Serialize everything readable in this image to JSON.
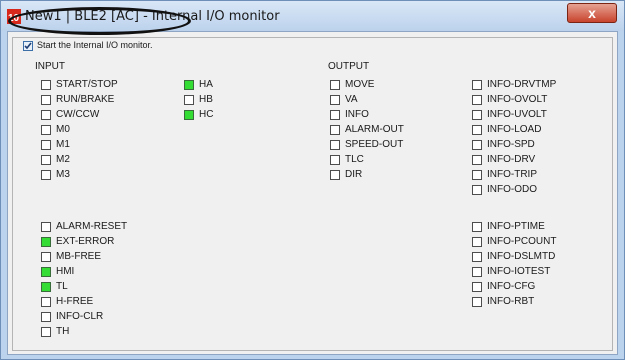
{
  "window": {
    "title": "New1 | BLE2 [AC] - Internal I/O monitor",
    "close_glyph": "x",
    "app_icon": "motor-app-icon",
    "title_bg": "#bcd3ee"
  },
  "start_monitor": {
    "label": "Start the Internal I/O monitor.",
    "checked": true
  },
  "input_header": "INPUT",
  "output_header": "OUTPUT",
  "colors": {
    "on": "#33dd33",
    "off": "#ffffff"
  },
  "io": {
    "start_stop": {
      "label": "START/STOP",
      "on": false
    },
    "run_brake": {
      "label": "RUN/BRAKE",
      "on": false
    },
    "cw_ccw": {
      "label": "CW/CCW",
      "on": false
    },
    "m0": {
      "label": "M0",
      "on": false
    },
    "m1": {
      "label": "M1",
      "on": false
    },
    "m2": {
      "label": "M2",
      "on": false
    },
    "m3": {
      "label": "M3",
      "on": false
    },
    "ha": {
      "label": "HA",
      "on": true
    },
    "hb": {
      "label": "HB",
      "on": false
    },
    "hc": {
      "label": "HC",
      "on": true
    },
    "alarm_reset": {
      "label": "ALARM-RESET",
      "on": false
    },
    "ext_error": {
      "label": "EXT-ERROR",
      "on": true
    },
    "mb_free": {
      "label": "MB-FREE",
      "on": false
    },
    "hmi": {
      "label": "HMI",
      "on": true
    },
    "tl": {
      "label": "TL",
      "on": true
    },
    "h_free": {
      "label": "H-FREE",
      "on": false
    },
    "info_clr": {
      "label": "INFO-CLR",
      "on": false
    },
    "th": {
      "label": "TH",
      "on": false
    },
    "move": {
      "label": "MOVE",
      "on": false
    },
    "va": {
      "label": "VA",
      "on": false
    },
    "info": {
      "label": "INFO",
      "on": false
    },
    "alarm_out": {
      "label": "ALARM-OUT",
      "on": false
    },
    "speed_out": {
      "label": "SPEED-OUT",
      "on": false
    },
    "tlc": {
      "label": "TLC",
      "on": false
    },
    "dir": {
      "label": "DIR",
      "on": false
    },
    "info_drvtmp": {
      "label": "INFO-DRVTMP",
      "on": false
    },
    "info_ovolt": {
      "label": "INFO-OVOLT",
      "on": false
    },
    "info_uvolt": {
      "label": "INFO-UVOLT",
      "on": false
    },
    "info_load": {
      "label": "INFO-LOAD",
      "on": false
    },
    "info_spd": {
      "label": "INFO-SPD",
      "on": false
    },
    "info_drv": {
      "label": "INFO-DRV",
      "on": false
    },
    "info_trip": {
      "label": "INFO-TRIP",
      "on": false
    },
    "info_odo": {
      "label": "INFO-ODO",
      "on": false
    },
    "info_ptime": {
      "label": "INFO-PTIME",
      "on": false
    },
    "info_pcount": {
      "label": "INFO-PCOUNT",
      "on": false
    },
    "info_dslmtd": {
      "label": "INFO-DSLMTD",
      "on": false
    },
    "info_iotest": {
      "label": "INFO-IOTEST",
      "on": false
    },
    "info_cfg": {
      "label": "INFO-CFG",
      "on": false
    },
    "info_rbt": {
      "label": "INFO-RBT",
      "on": false
    }
  }
}
